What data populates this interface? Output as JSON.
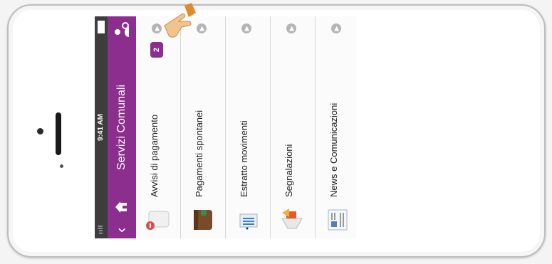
{
  "status_bar": {
    "carrier": "ııll",
    "time": "9:41 AM"
  },
  "nav": {
    "title": "Servizi Comunali",
    "back_icon": "chevron-left-icon",
    "home_icon": "home-icon",
    "user_icon": "user-settings-icon"
  },
  "menu": {
    "items": [
      {
        "label": "Avvisi di pagamento",
        "icon": "payment-notice-icon",
        "badge": "2"
      },
      {
        "label": "Pagamenti spontanei",
        "icon": "wallet-icon",
        "badge": ""
      },
      {
        "label": "Estratto movimenti",
        "icon": "bank-statement-icon",
        "badge": ""
      },
      {
        "label": "Segnalazioni",
        "icon": "megaphone-icon",
        "badge": ""
      },
      {
        "label": "News e Comunicazioni",
        "icon": "newspaper-icon",
        "badge": ""
      }
    ]
  },
  "colors": {
    "accent": "#8b2e8d",
    "status_bar": "#3d3d3d"
  }
}
